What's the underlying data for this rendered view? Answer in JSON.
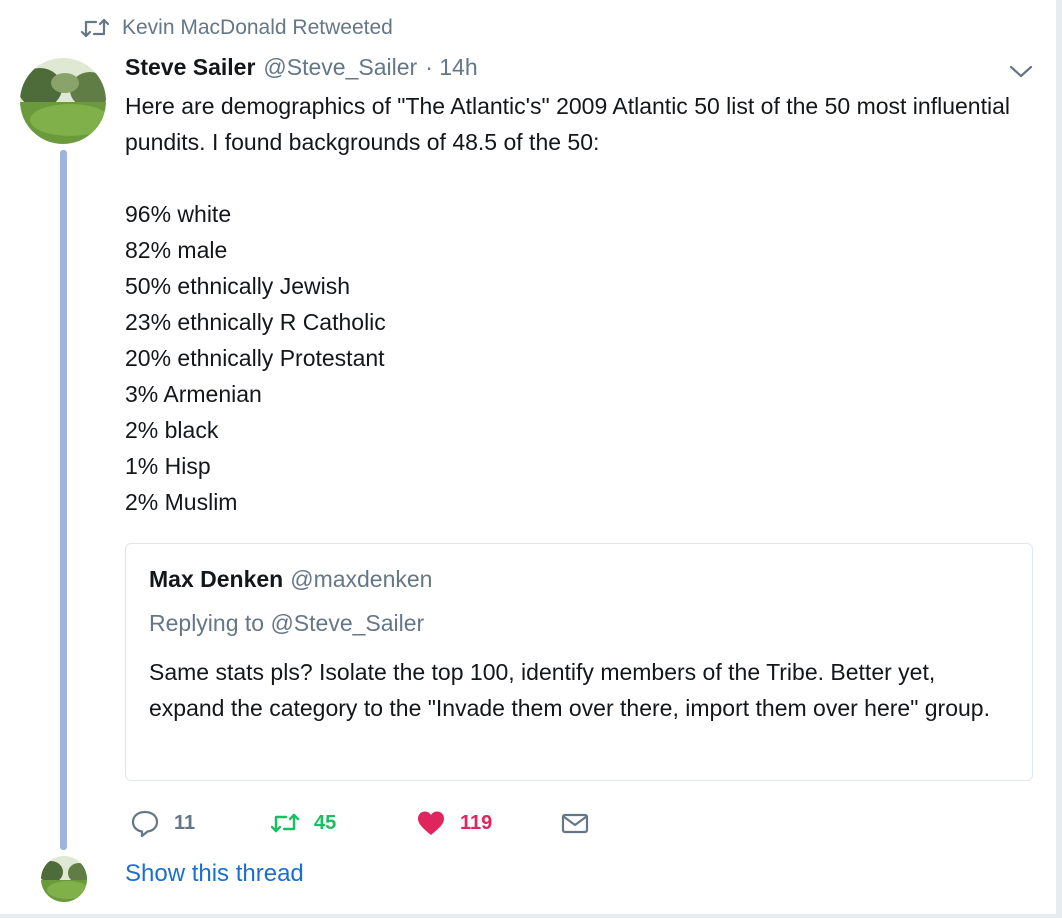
{
  "retweet_context": {
    "icon": "retweet-icon",
    "text": "Kevin MacDonald Retweeted"
  },
  "tweet": {
    "fullname": "Steve Sailer",
    "username": "@Steve_Sailer",
    "timestamp": "· 14h",
    "text_intro": "Here are demographics of \"The Atlantic's\" 2009 Atlantic 50 list of the 50 most influential pundits. I found backgrounds of 48.5 of the 50:",
    "stats": [
      "96% white",
      "82% male",
      "50% ethnically Jewish",
      "23% ethnically R Catholic",
      "20% ethnically Protestant",
      "3% Armenian",
      "2% black",
      "1% Hisp",
      "2% Muslim"
    ]
  },
  "quote": {
    "fullname": "Max Denken",
    "username": "@maxdenken",
    "replying_to": "Replying to @Steve_Sailer",
    "text": "Same stats pls? Isolate the top 100, identify members of the Tribe. Better yet, expand the category to the \"Invade them over there, import them over here\" group."
  },
  "actions": {
    "reply_count": "11",
    "retweet_count": "45",
    "like_count": "119"
  },
  "show_thread": "Show this thread",
  "colors": {
    "retweet_green": "#17bf63",
    "like_red": "#e0245e",
    "link_blue": "#1b6fd1",
    "muted_gray": "#657786",
    "thread_line": "#9fb3de"
  }
}
